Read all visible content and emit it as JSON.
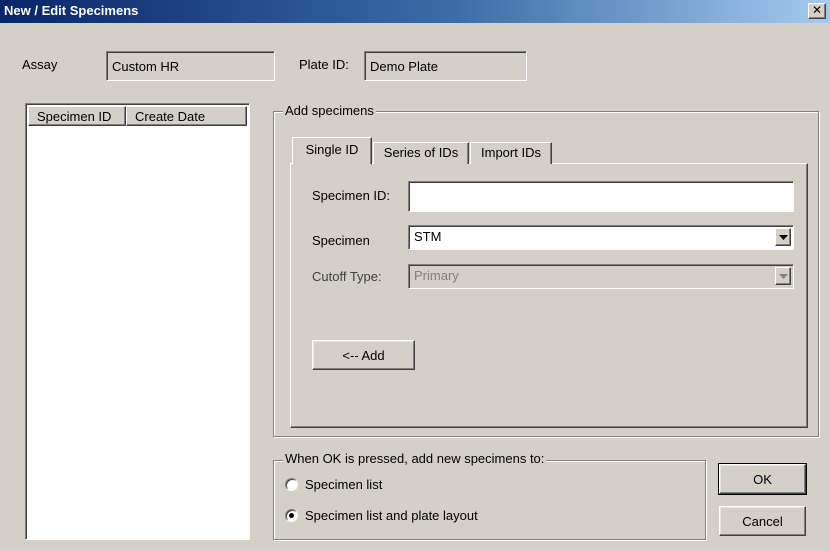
{
  "window": {
    "title": "New / Edit Specimens",
    "close_glyph": "✕"
  },
  "assay": {
    "label": "Assay",
    "value": "Custom HR"
  },
  "plate": {
    "label": "Plate ID:",
    "value": "Demo Plate"
  },
  "specimen_list": {
    "columns": [
      "Specimen ID",
      "Create Date"
    ],
    "rows": []
  },
  "add_group": {
    "title": "Add specimens",
    "tabs": [
      {
        "label": "Single ID",
        "selected": true
      },
      {
        "label": "Series of IDs",
        "selected": false
      },
      {
        "label": "Import IDs",
        "selected": false
      }
    ],
    "specimen_id": {
      "label": "Specimen ID:",
      "value": ""
    },
    "specimen": {
      "label": "Specimen",
      "value": "STM"
    },
    "cutoff_type": {
      "label": "Cutoff Type:",
      "value": "Primary",
      "enabled": false
    },
    "add_button": "<-- Add"
  },
  "ok_group": {
    "title": "When OK is pressed, add new specimens to:",
    "options": [
      {
        "label": "Specimen list",
        "checked": false
      },
      {
        "label": "Specimen list and plate layout",
        "checked": true
      }
    ]
  },
  "buttons": {
    "ok": "OK",
    "cancel": "Cancel"
  },
  "icons": {
    "dropdown": "chevron-down-icon",
    "close": "close-icon"
  }
}
